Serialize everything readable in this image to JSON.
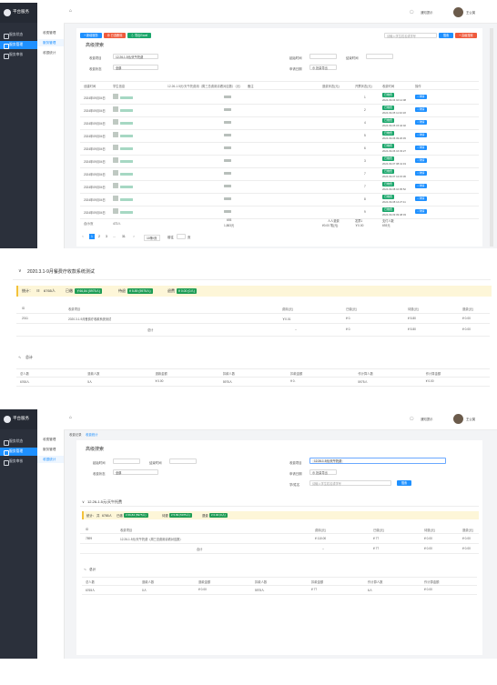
{
  "app": {
    "title": "平台服务",
    "user": "王公英",
    "notify": "通知提示"
  },
  "sidebar": {
    "items": [
      {
        "label": "服务状态"
      },
      {
        "label": "服务管理"
      },
      {
        "label": "服务审核"
      }
    ]
  },
  "submenu": {
    "s1": [
      "收费管理",
      "服务管理",
      "收银统计"
    ],
    "s3": [
      "收费管理",
      "服务管理",
      "收银统计"
    ]
  },
  "s1": {
    "buttons": {
      "add": "+ 新增服务",
      "delete": "⊗ 已选删除",
      "export": "⇩ 导出Excel"
    },
    "search_placeholder": "请输入学生姓名或学号",
    "search_btn": "搜索",
    "advanced_btn": "+ 高级搜索",
    "panel_title": "高级搜索",
    "fields": {
      "item": "收费项目",
      "item_value": "12.26-1.5元/天午托费",
      "status": "收费状态",
      "status_value": "全部",
      "start": "起始时间",
      "end": "结束时间",
      "date": "申请日期",
      "download": "⊕ 批量导出"
    },
    "columns": [
      "创建时间",
      "学生信息",
      "12.26-1.5元/天午托费用（周三总费用请看对应数）（元）",
      "备注",
      "退费状态(元)",
      "开票状态(元)",
      "收费时间",
      "操作"
    ],
    "rows": [
      {
        "time": "2024年09月04日",
        "status": "已缴费",
        "pay_time": "2024-09-04 10:14:08",
        "num": "1"
      },
      {
        "time": "2024年09月04日",
        "status": "已缴费",
        "pay_time": "2024-09-05 11:02:18",
        "num": "2"
      },
      {
        "time": "2024年09月04日",
        "status": "已缴费",
        "pay_time": "2024-09-05 15:42:02",
        "num": "4"
      },
      {
        "time": "2024年09月04日",
        "status": "已缴费",
        "pay_time": "2024-09-06 09:20:45",
        "num": "5"
      },
      {
        "time": "2024年09月04日",
        "status": "已缴费",
        "pay_time": "2024-09-06 16:33:27",
        "num": "6"
      },
      {
        "time": "2024年09月04日",
        "status": "已缴费",
        "pay_time": "2024-09-07 08:41:19",
        "num": "3"
      },
      {
        "time": "2024年09月04日",
        "status": "已缴费",
        "pay_time": "2024-09-07 12:15:36",
        "num": "7"
      },
      {
        "time": "2024年09月04日",
        "status": "已缴费",
        "pay_time": "2024-09-08 10:05:52",
        "num": "7"
      },
      {
        "time": "2024年09月04日",
        "status": "已缴费",
        "pay_time": "2024-09-08 14:27:11",
        "num": "8"
      },
      {
        "time": "2024年09月04日",
        "status": "已缴费",
        "pay_time": "2024-09-09 09:48:03",
        "num": "9"
      }
    ],
    "row_action": "• 详情",
    "total": {
      "label": "合计/页",
      "count": "473人",
      "amount": "693",
      "sub": "1,883元",
      "refund": "人人退费",
      "refund_amt": "¥0.00 笔(元)",
      "inv": "发票1",
      "inv_amt": "￥0.00",
      "paid": "支付人数",
      "paid_amt": "693元"
    },
    "pagination": {
      "pages": [
        "1",
        "2",
        "3",
        "...",
        "31"
      ],
      "next": ">",
      "size": "10条/页",
      "jump": "前往",
      "page_label": "页"
    }
  },
  "s2": {
    "title": "2020.3.1-9月餐费疗收款系统测试",
    "stats": {
      "label": "统计：",
      "count_label": "共",
      "count": "6765人",
      "paid_label": "已缴",
      "paid": "￥66,84 (5975人)",
      "wait_label": "待退",
      "wait": "¥ 5.89 (5975人)",
      "refund_label": "退费",
      "refund": "¥ 0.00 (0人)"
    },
    "columns": [
      "ID",
      "收费项目",
      "费用(元)",
      "已缴(元)",
      "待退(元)",
      "退费(元)"
    ],
    "row": {
      "id": "2011",
      "name": "2020.3.1-9月餐费疗收款系统测试",
      "fee": "￥0.01",
      "paid": "¥ 0.",
      "wait": "¥ 5.80",
      "refund": "¥ 0.00"
    },
    "sum": {
      "label": "总计",
      "fee": "--",
      "paid": "¥ 0.",
      "wait": "¥ 5.80",
      "refund": "¥ 0.00"
    },
    "totals_title": "总计",
    "totals_cols": [
      "总人数",
      "退款人数",
      "退款金额",
      "扣款人数",
      "扣款金额",
      "作计算人数",
      "作计算金额"
    ],
    "totals_vals": [
      "6765人",
      "5人",
      "¥ 0.00",
      "5975人",
      "¥ 0.",
      "5975人",
      "¥ 0.00"
    ]
  },
  "s3": {
    "crumb": [
      "收费记录",
      "收费统计"
    ],
    "panel_title": "高级搜索",
    "fields": {
      "start": "起始时间",
      "end": "结束时间",
      "status": "收费状态",
      "status_value": "全部",
      "item": "收费项目",
      "item_value": "12.26-1.5元/天午托费",
      "date": "申请日期",
      "download": "⊕ 批量导出",
      "search": "学/姓名",
      "search_ph": "请输入学生姓名或学号",
      "search_btn": "搜索"
    },
    "section": "12.26-1.5元/天午托费",
    "stats": {
      "label": "统计：",
      "count_label": "共",
      "count": "6765人",
      "paid_label": "已缴",
      "paid": "¥ 66,84 (5975人)",
      "wait_label": "待退",
      "wait": "¥ 5.89 (5975人)",
      "refund_label": "退费",
      "refund": "¥ 0.00 (0人)"
    },
    "columns": [
      "ID",
      "收费项目",
      "费用(元)",
      "已缴(元)",
      "待退(元)",
      "退费(元)"
    ],
    "row": {
      "id": "7899",
      "name": "12.26-1.5元/天午托费（周三总费用请看对应数）",
      "fee": "¥ 110.00",
      "paid": "¥ 77",
      "wait": "¥ 0.00",
      "refund": "¥ 0.00"
    },
    "sum": {
      "label": "合计",
      "fee": "--",
      "paid": "¥ 77",
      "wait": "¥ 0.00",
      "refund": "¥ 0.00"
    },
    "totals_title": "总计",
    "totals_cols": [
      "总人数",
      "退款人数",
      "退款金额",
      "扣款人数",
      "扣款金额",
      "作计算人数",
      "作计算金额"
    ],
    "totals_vals": [
      "6765人",
      "0人",
      "¥ 0.00",
      "5975人",
      "¥ 77",
      "6人",
      "¥ 0.00"
    ]
  }
}
